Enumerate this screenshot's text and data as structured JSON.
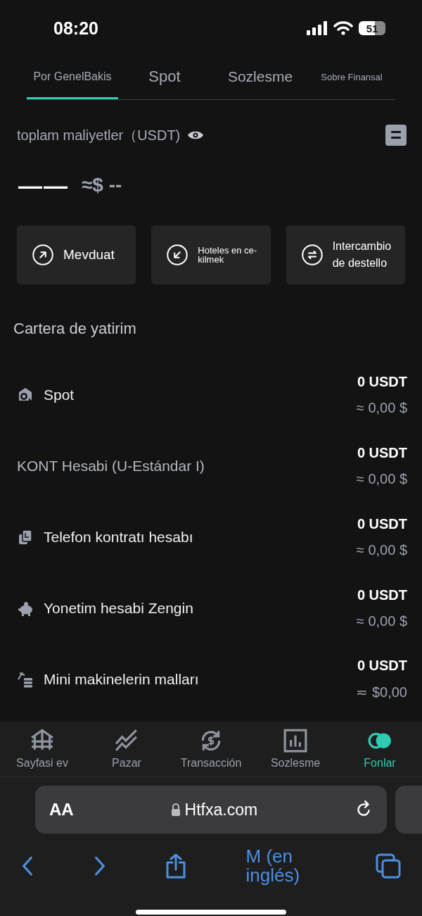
{
  "status_bar": {
    "time": "08:20",
    "battery": "51"
  },
  "tabs": [
    {
      "label": "Por GenelBakis",
      "selected": true
    },
    {
      "label": "Spot",
      "selected": false
    },
    {
      "label": "Sozlesme",
      "selected": false
    },
    {
      "label": "Sobre Finansal",
      "selected": false
    }
  ],
  "balance": {
    "label": "toplam maliyetler（USDT)",
    "amount": "——",
    "fiat": "≈$ --"
  },
  "actions": [
    {
      "kind": "deposit",
      "label": "Mevduat"
    },
    {
      "kind": "withdraw",
      "label": "Hoteles en ce-kilmek"
    },
    {
      "kind": "exchange",
      "label": "Intercambio de destello"
    }
  ],
  "portfolio": {
    "title": "Cartera de yatirim",
    "accounts": [
      {
        "kind": "spot",
        "name": "Spot",
        "amount": "0 USDT",
        "fiat": "≈ 0,00 $"
      },
      {
        "kind": "plain",
        "name": "KONT Hesabi (U-Estándar I)",
        "amount": "0 USDT",
        "fiat": "≈ 0,00 $"
      },
      {
        "kind": "phone",
        "name": "Telefon kontratı hesabı",
        "amount": "0 USDT",
        "fiat": "≈ 0,00 $"
      },
      {
        "kind": "piggy",
        "name": "Yonetim hesabi Zengin",
        "amount": "0 USDT",
        "fiat": "≈ 0,00 $"
      },
      {
        "kind": "mining",
        "name": "Mini makinelerin malları",
        "amount": "0 USDT",
        "fiat": "≂ $0,00"
      }
    ]
  },
  "bottom_nav": [
    {
      "kind": "home",
      "label": "Sayfasi ev",
      "selected": false
    },
    {
      "kind": "market",
      "label": "Pazar",
      "selected": false
    },
    {
      "kind": "trade",
      "label": "Transacción",
      "selected": false
    },
    {
      "kind": "contract",
      "label": "Sozlesme",
      "selected": false
    },
    {
      "kind": "funds",
      "label": "Fonlar",
      "selected": true
    }
  ],
  "browser": {
    "text_size": "AA",
    "url": "Htfxa.com",
    "toolbar_text": "M (en inglés)"
  }
}
